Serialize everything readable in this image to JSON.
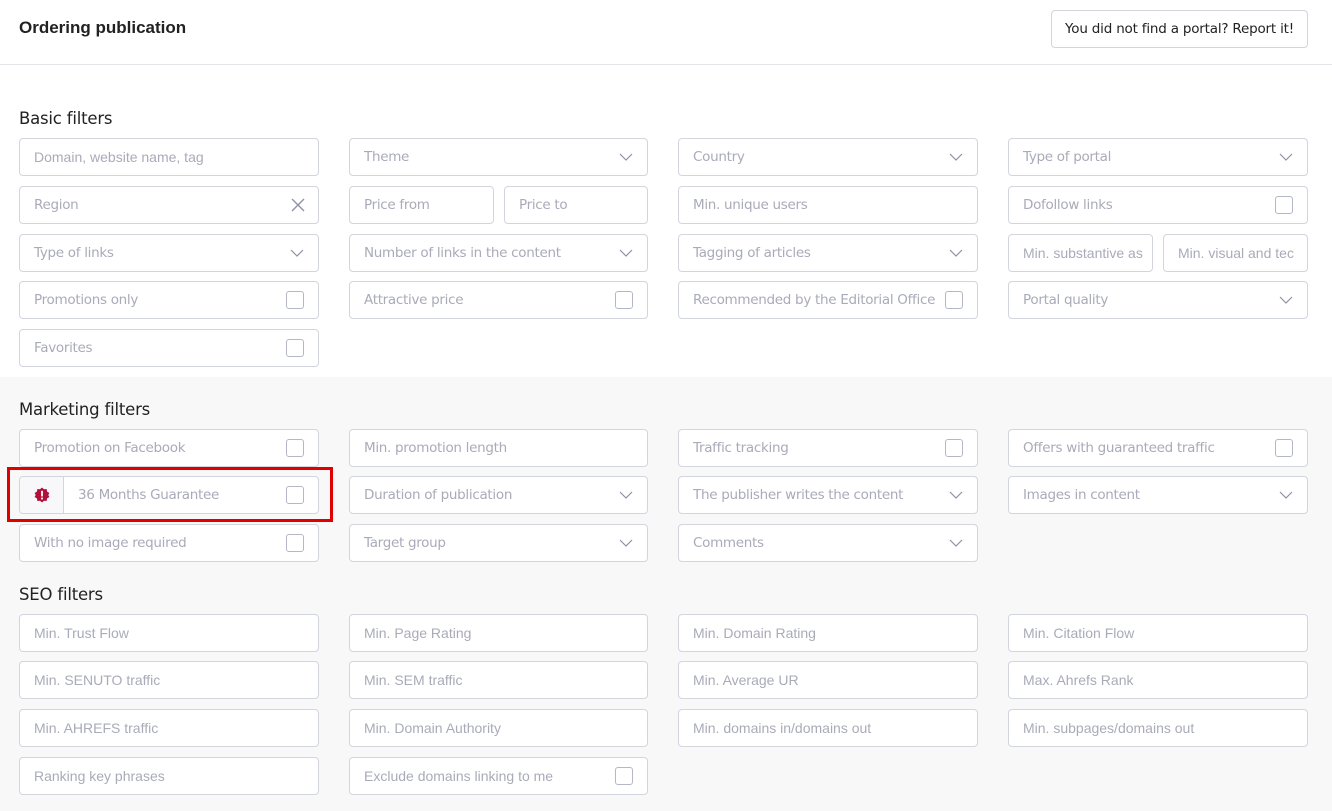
{
  "header": {
    "title": "Ordering publication",
    "report_button": "You did not find a portal? Report it!"
  },
  "basic_filters": {
    "title": "Basic filters",
    "domain_search": "Domain, website name, tag",
    "theme": "Theme",
    "country": "Country",
    "type_of_portal": "Type of portal",
    "region": "Region",
    "price_from": "Price from",
    "price_to": "Price to",
    "min_unique_users": "Min. unique users",
    "dofollow_links": "Dofollow links",
    "type_of_links": "Type of links",
    "number_of_links": "Number of links in the content",
    "tagging_of_articles": "Tagging of articles",
    "min_substantive": "Min. substantive as",
    "min_visual": "Min. visual and tec",
    "promotions_only": "Promotions only",
    "attractive_price": "Attractive price",
    "recommended": "Recommended by the Editorial Office",
    "portal_quality": "Portal quality",
    "favorites": "Favorites"
  },
  "marketing_filters": {
    "title": "Marketing filters",
    "promotion_facebook": "Promotion on Facebook",
    "min_promotion_length": "Min. promotion length",
    "traffic_tracking": "Traffic tracking",
    "guaranteed_traffic": "Offers with guaranteed traffic",
    "guarantee_36": "36 Months Guarantee",
    "duration_of_publication": "Duration of publication",
    "publisher_writes": "The publisher writes the content",
    "images_in_content": "Images in content",
    "no_image_required": "With no image required",
    "target_group": "Target group",
    "comments": "Comments"
  },
  "seo_filters": {
    "title": "SEO filters",
    "min_trust_flow": "Min. Trust Flow",
    "min_page_rating": "Min. Page Rating",
    "min_domain_rating": "Min. Domain Rating",
    "min_citation_flow": "Min. Citation Flow",
    "min_senuto_traffic": "Min. SENUTO traffic",
    "min_sem_traffic": "Min. SEM traffic",
    "min_average_ur": "Min. Average UR",
    "max_ahrefs_rank": "Max. Ahrefs Rank",
    "min_ahrefs_traffic": "Min. AHREFS traffic",
    "min_domain_authority": "Min. Domain Authority",
    "min_domains_in_out": "Min. domains in/domains out",
    "min_subpages_out": "Min. subpages/domains out",
    "ranking_key_phrases": "Ranking key phrases",
    "exclude_domains": "Exclude domains linking to me"
  },
  "colors": {
    "alert_badge": "#b0103a",
    "highlight": "#e00000"
  }
}
